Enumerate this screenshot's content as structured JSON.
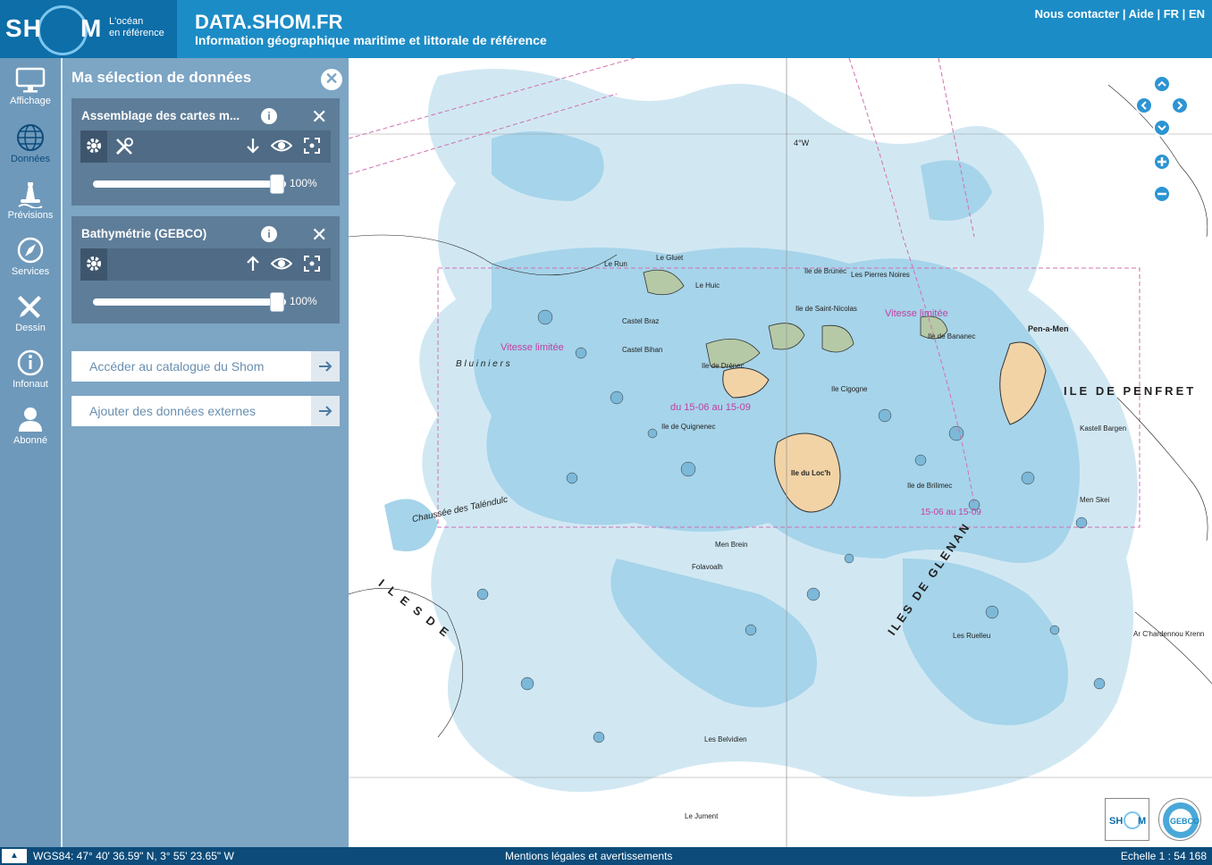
{
  "header": {
    "logo_left": "SH",
    "logo_right": "M",
    "tagline_1": "L'océan",
    "tagline_2": "en référence",
    "title": "DATA.SHOM.FR",
    "subtitle": "Information géographique maritime et littorale de référence",
    "links": {
      "contact": "Nous contacter",
      "help": "Aide",
      "fr": "FR",
      "en": "EN",
      "separator": " | "
    }
  },
  "iconbar": {
    "items": [
      {
        "label": "Affichage",
        "icon": "monitor-icon"
      },
      {
        "label": "Données",
        "icon": "globe-icon"
      },
      {
        "label": "Prévisions",
        "icon": "buoy-icon"
      },
      {
        "label": "Services",
        "icon": "compass-icon"
      },
      {
        "label": "Dessin",
        "icon": "pencil-ruler-icon"
      },
      {
        "label": "Infonaut",
        "icon": "info-icon"
      },
      {
        "label": "Abonné",
        "icon": "user-icon"
      }
    ],
    "active": "Données"
  },
  "panel": {
    "title": "Ma sélection de données",
    "layers": [
      {
        "name": "Assemblage des cartes m...",
        "opacity_label": "100%",
        "opacity": 1.0
      },
      {
        "name": "Bathymétrie (GEBCO)",
        "opacity_label": "100%",
        "opacity": 1.0
      }
    ],
    "catalog_button": "Accéder au catalogue du Shom",
    "external_button": "Ajouter des données externes"
  },
  "map": {
    "labels": {
      "penfret": "ILE DE PENFRET",
      "glenan": "ILES DE GLENAN",
      "iles_de": "I L E S   D E",
      "loch": "Ile du Loc'h",
      "pen_a_men": "Pen-a-Men",
      "vitesse": "Vitesse limitée",
      "bluiniers": "B l u i n i e r s",
      "chaussee": "Chaussée des Taléndulc",
      "drenec": "Ile de Drénec",
      "cigogne": "Ile Cigogne",
      "bananec": "Ile de Bananec",
      "brilimec": "Ile de Brilimec",
      "quignenec": "Ile de Quignenec",
      "saint_nicolas": "Ile de Saint-Nicolas",
      "brunec": "Ile de Brunec",
      "le_guiet": "Le Gluet",
      "castel_braz": "Castel Braz",
      "castel_bihan": "Castel Bihan",
      "le_huic": "Le Huic",
      "lon_4w": "4°W",
      "pierres_noires": "Les Pierres Noires",
      "men_skei": "Men Skei",
      "kastel_bargen": "Kastell Bargen",
      "les_ruelleu": "Les Ruelleu",
      "le_run": "Le Run",
      "ar_chardennou": "Ar C'hardennou Krenn",
      "men_brein": "Men Brein",
      "folavoalh": "Folavoalh",
      "les_belvidien": "Les Belvidien",
      "le_jument": "Le Jument",
      "vitesse_2": "Vitesse limitée",
      "dates_1": "du 15-06 au 15-09",
      "dates_2": "15-06 au 15-09"
    }
  },
  "footer": {
    "coords": "WGS84: 47° 40' 36.59\" N, 3° 55' 23.65\" W",
    "legal": "Mentions légales et avertissements",
    "scale": "Echelle 1 : 54 168",
    "toggle": "▲"
  },
  "colors": {
    "header_bg": "#1c8cc6",
    "logo_bg": "#0d6ea8",
    "iconbar_bg": "#6e99bb",
    "panel_bg": "#7da5c4",
    "card_bg": "#5e7d98",
    "footer_bg": "#0d4c7a",
    "shallow_water": "#a6d4ea",
    "mid_water": "#d1e8f3",
    "land": "#f1d3a6",
    "marsh": "#b5c9a6"
  },
  "corner_logos": [
    "SHOM",
    "GEBCO"
  ]
}
